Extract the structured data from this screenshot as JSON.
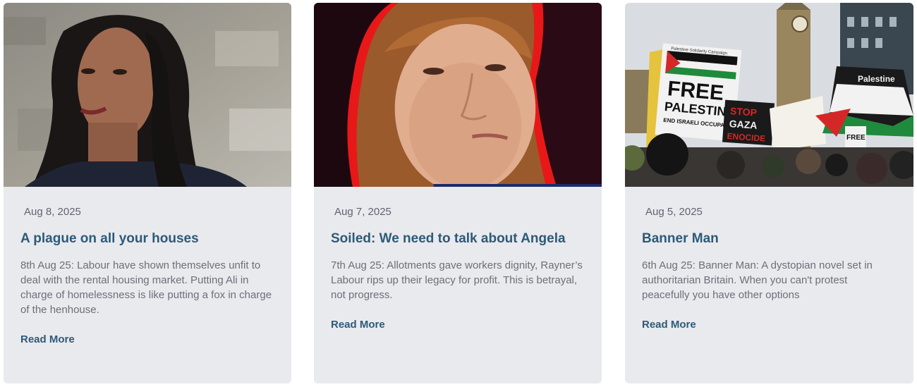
{
  "posts": [
    {
      "date": "Aug 8, 2025",
      "title": "A plague on all your houses",
      "excerpt": "8th Aug 25: Labour have shown themselves unfit to deal with the rental housing market. Putting Ali in charge of homelessness is like putting a fox in charge of the henhouse.",
      "read_more": "Read More"
    },
    {
      "date": "Aug 7, 2025",
      "title": "Soiled: We need to talk about Angela",
      "excerpt": "7th Aug 25: Allotments gave workers dignity, Rayner’s Labour rips up their legacy for profit. This is betrayal, not progress.",
      "read_more": "Read More"
    },
    {
      "date": "Aug 5, 2025",
      "title": "Banner Man",
      "excerpt": "6th Aug 25: Banner Man: A dystopian novel set in authoritarian Britain. When you can't protest peacefully you have other options",
      "read_more": "Read More"
    }
  ],
  "images": {
    "post1": {
      "banner_text": []
    },
    "post2": {
      "banner_text": []
    },
    "post3": {
      "banner_text": [
        "FREE",
        "PALESTINE",
        "END ISRAELI OCCUPATION",
        "STOP",
        "GAZA",
        "ENOCIDE",
        "Palestine",
        "FREE",
        "Palestine Solidarity Campaign"
      ]
    }
  },
  "colors": {
    "card_bg": "#e9eaee",
    "title": "#2d5a78",
    "date": "#606470",
    "excerpt": "#6b6f78"
  }
}
